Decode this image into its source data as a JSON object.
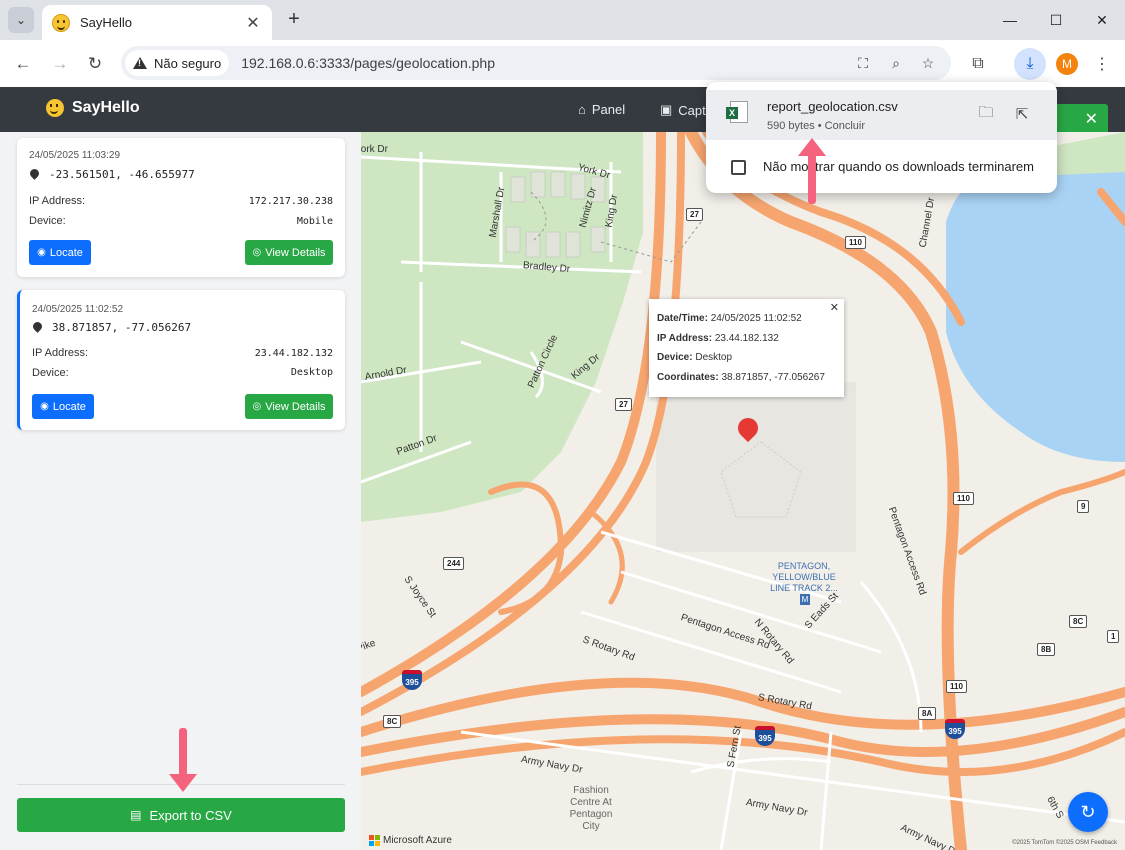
{
  "browser": {
    "tab_title": "SayHello",
    "security_label": "Não seguro",
    "url": "192.168.0.6:3333/pages/geolocation.php",
    "profile_initial": "M"
  },
  "download": {
    "filename": "report_geolocation.csv",
    "meta": "590 bytes • Concluir",
    "checkbox_label": "Não mostrar quando os downloads terminarem"
  },
  "app": {
    "brand": "SayHello",
    "nav": [
      {
        "label": "Panel",
        "icon": "home-icon"
      },
      {
        "label": "Capt",
        "icon": "images-icon"
      }
    ]
  },
  "records": [
    {
      "datetime": "24/05/2025 11:03:29",
      "coords": "-23.561501, -46.655977",
      "ip_label": "IP Address:",
      "ip": "172.217.30.238",
      "device_label": "Device:",
      "device": "Mobile",
      "locate_label": "Locate",
      "details_label": "View Details"
    },
    {
      "datetime": "24/05/2025 11:02:52",
      "coords": "38.871857, -77.056267",
      "ip_label": "IP Address:",
      "ip": "23.44.182.132",
      "device_label": "Device:",
      "device": "Desktop",
      "locate_label": "Locate",
      "details_label": "View Details"
    }
  ],
  "export_label": "Export to CSV",
  "popup": {
    "datetime_label": "Date/Time:",
    "datetime": "24/05/2025 11:02:52",
    "ip_label": "IP Address:",
    "ip": "23.44.182.132",
    "device_label": "Device:",
    "device": "Desktop",
    "coords_label": "Coordinates:",
    "coords": "38.871857, -77.056267"
  },
  "map": {
    "streets": [
      "York Dr",
      "York Dr",
      "Marshall Dr",
      "Nimitz Dr",
      "King Dr",
      "Bradley Dr",
      "Arnold Dr",
      "Patton Circle",
      "King Dr",
      "Patton Dr",
      "S Joyce St",
      "Pentagon Access Rd",
      "S Rotary Rd",
      "N Rotary Rd",
      "S Eads St",
      "Pentagon Access Rd",
      "S Rotary Rd",
      "Army Navy Dr",
      "Army Navy Dr",
      "Army Navy Dr",
      "S Fern St",
      "Channel Dr",
      "6th S",
      "Pike"
    ],
    "route_shields": [
      "27",
      "110",
      "27",
      "244",
      "110",
      "9",
      "8C",
      "8B",
      "8A",
      "8C",
      "110",
      "1"
    ],
    "interstates": [
      "395",
      "395",
      "395"
    ],
    "poi": "PENTAGON, YELLOW/BLUE LINE TRACK 2...",
    "poi_badge": "M",
    "fashion_center": "Fashion Centre At Pentagon City",
    "attribution_left": "Microsoft Azure",
    "attribution_right": "©2025 TomTom  ©2025 OSM  Feedback"
  },
  "colors": {
    "navbar": "#343a40",
    "primary": "#0d6efd",
    "success": "#28a745",
    "marker": "#e53935",
    "highway": "#f7a56f",
    "park": "#cfe6c2",
    "water": "#a9d3f5",
    "annotation": "#f4627e"
  }
}
